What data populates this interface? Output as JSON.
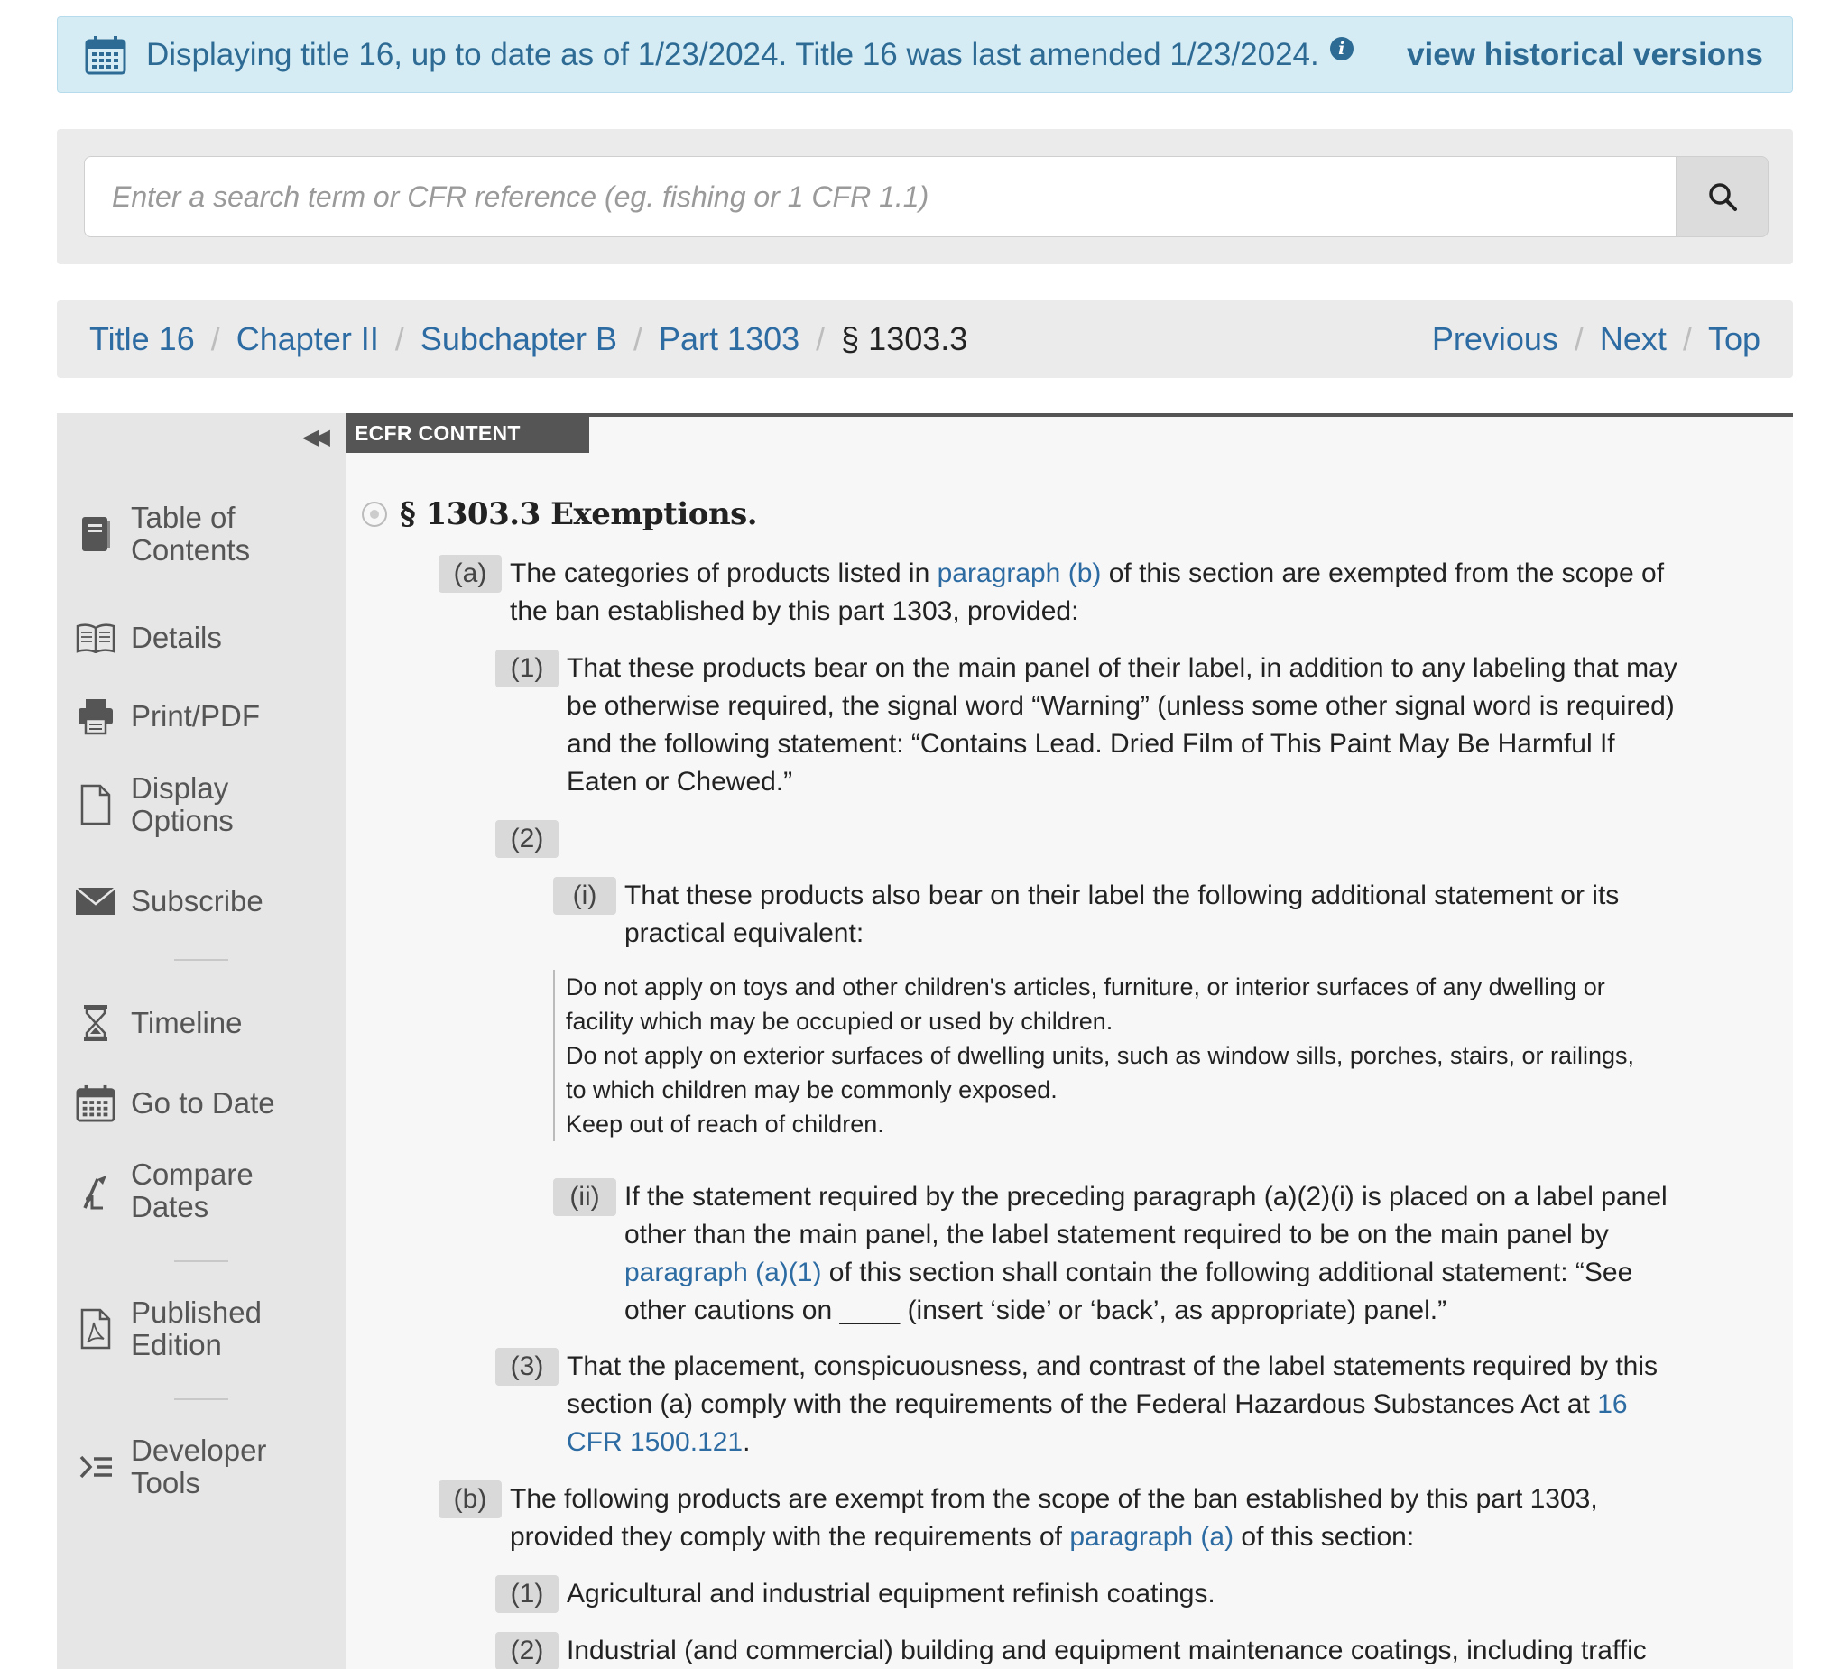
{
  "banner": {
    "message": "Displaying title 16, up to date as of 1/23/2024. Title 16 was last amended 1/23/2024.",
    "info_glyph": "i",
    "historical_link": "view historical versions",
    "icon": "calendar-icon"
  },
  "search": {
    "placeholder": "Enter a search term or CFR reference (eg. fishing or 1 CFR 1.1)",
    "value": "",
    "button_icon": "search-icon"
  },
  "breadcrumb": {
    "items": [
      "Title 16",
      "Chapter II",
      "Subchapter B",
      "Part 1303"
    ],
    "current": "§ 1303.3",
    "separator": "/",
    "nav": [
      "Previous",
      "Next",
      "Top"
    ]
  },
  "sidebar": {
    "collapse_glyph": "◀◀",
    "items": [
      {
        "label_lines": [
          "Table of",
          "Contents"
        ],
        "icon": "book-icon"
      },
      {
        "label_lines": [
          "Details"
        ],
        "icon": "open-book-icon"
      },
      {
        "label_lines": [
          "Print/PDF"
        ],
        "icon": "printer-icon"
      },
      {
        "label_lines": [
          "Display",
          "Options"
        ],
        "icon": "document-icon"
      },
      {
        "label_lines": [
          "Subscribe"
        ],
        "icon": "envelope-icon"
      },
      {
        "label_lines": [
          "Timeline"
        ],
        "icon": "hourglass-icon"
      },
      {
        "label_lines": [
          "Go to Date"
        ],
        "icon": "calendar-icon"
      },
      {
        "label_lines": [
          "Compare",
          "Dates"
        ],
        "icon": "compare-icon"
      },
      {
        "label_lines": [
          "Published",
          "Edition"
        ],
        "icon": "pdf-file-icon"
      },
      {
        "label_lines": [
          "Developer",
          "Tools"
        ],
        "icon": "code-icon"
      }
    ]
  },
  "content": {
    "tab_label": "ECFR CONTENT",
    "section_title": "§ 1303.3 Exemptions.",
    "a": {
      "num": "(a)",
      "line1_pre": "The categories of products listed in ",
      "line1_link": "paragraph (b)",
      "line1_post": " of this section are exempted from the scope of",
      "line2": "the ban established by this part 1303, provided:"
    },
    "a1": {
      "num": "(1)",
      "lines": [
        "That these products bear on the main panel of their label, in addition to any labeling that may",
        "be otherwise required, the signal word “Warning” (unless some other signal word is required)",
        "and the following statement: “Contains Lead. Dried Film of This Paint May Be Harmful If",
        "Eaten or Chewed.”"
      ]
    },
    "a2": {
      "num": "(2)"
    },
    "a2i": {
      "num": "(i)",
      "lines": [
        "That these products also bear on their label the following additional statement or its",
        "practical equivalent:"
      ]
    },
    "quote_lines": [
      "Do not apply on toys and other children's articles, furniture, or interior surfaces of any dwelling or",
      "facility which may be occupied or used by children.",
      "Do not apply on exterior surfaces of dwelling units, such as window sills, porches, stairs, or railings,",
      "to which children may be commonly exposed.",
      "Keep out of reach of children."
    ],
    "a2ii": {
      "num": "(ii)",
      "line1": "If the statement required by the preceding paragraph (a)(2)(i) is placed on a label panel",
      "line2": "other than the main panel, the label statement required to be on the main panel by",
      "line3_link": "paragraph (a)(1)",
      "line3_post": " of this section shall contain the following additional statement: “See",
      "line4": "other cautions on ____ (insert ‘side’ or ‘back’, as appropriate) panel.”"
    },
    "a3": {
      "num": "(3)",
      "line1": "That the placement, conspicuousness, and contrast of the label statements required by this",
      "line2_pre": "section (a) comply with the requirements of the Federal Hazardous Substances Act at ",
      "line2_link": "16",
      "line3_link": "CFR 1500.121",
      "line3_post": "."
    },
    "b": {
      "num": "(b)",
      "line1": "The following products are exempt from the scope of the ban established by this part 1303,",
      "line2_pre": "provided they comply with the requirements of ",
      "line2_link": "paragraph (a)",
      "line2_post": " of this section:"
    },
    "b1": {
      "num": "(1)",
      "text": "Agricultural and industrial equipment refinish coatings."
    },
    "b2": {
      "num": "(2)",
      "text": "Industrial (and commercial) building and equipment maintenance coatings, including traffic"
    }
  }
}
